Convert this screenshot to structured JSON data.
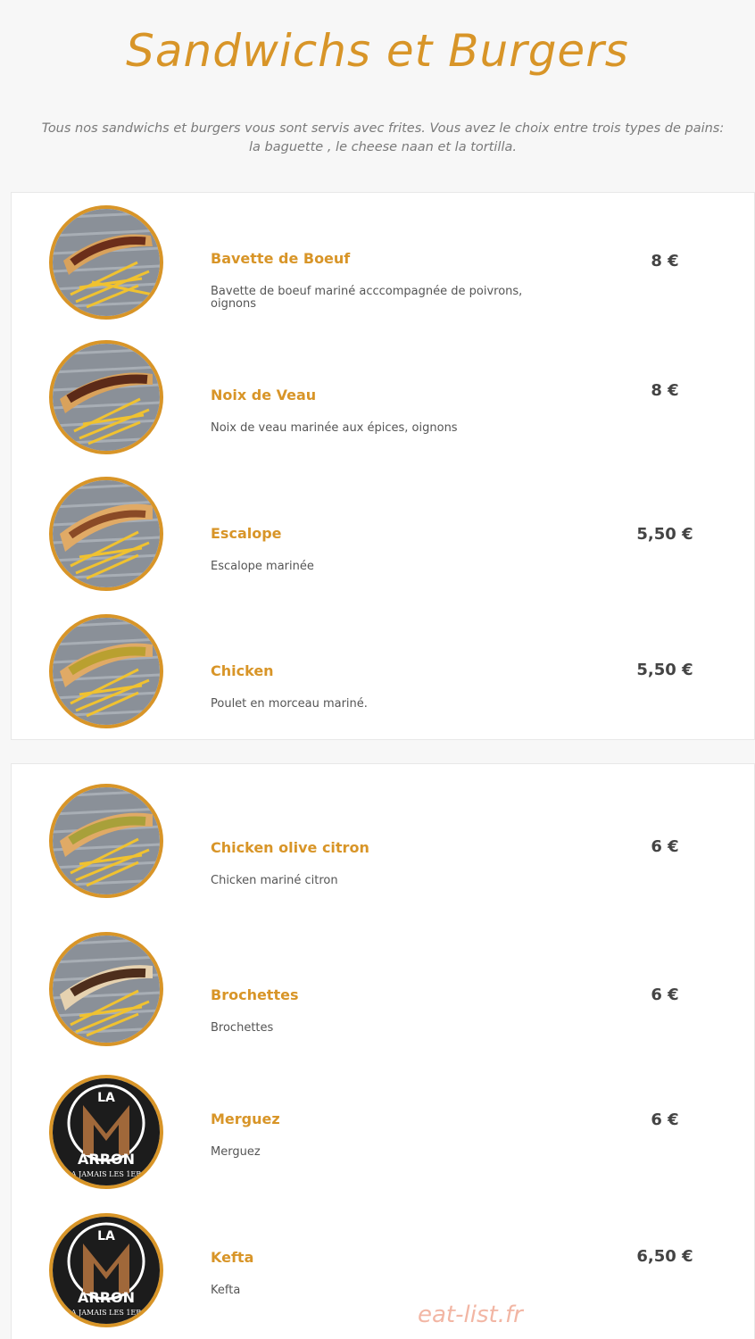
{
  "page": {
    "title": "Sandwichs et Burgers",
    "intro_line1": "Tous nos sandwichs et burgers vous sont servis avec frites. Vous avez le choix entre trois types de pains:",
    "intro_line2": "la baguette , le cheese naan et la tortilla."
  },
  "colors": {
    "accent": "#d89528",
    "price": "#444444",
    "text": "#555555",
    "background": "#f7f7f7"
  },
  "menu_group_1": [
    {
      "name": "Bavette de Boeuf",
      "description": "Bavette de boeuf mariné acccompagnée de poivrons, oignons",
      "price": "8 €",
      "image": "sandwich-fries-photo"
    },
    {
      "name": "Noix de Veau",
      "description": "Noix de veau marinée aux épices, oignons",
      "price": "8 €",
      "image": "sandwich-fries-photo"
    },
    {
      "name": "Escalope",
      "description": "Escalope marinée",
      "price": "5,50 €",
      "image": "sandwich-fries-photo"
    },
    {
      "name": "Chicken",
      "description": "Poulet en morceau mariné.",
      "price": "5,50 €",
      "image": "sandwich-fries-photo"
    }
  ],
  "menu_group_2": [
    {
      "name": "Chicken olive citron",
      "description": "Chicken mariné citron",
      "price": "6 €",
      "image": "sandwich-fries-photo"
    },
    {
      "name": "Brochettes",
      "description": "Brochettes",
      "price": "6 €",
      "image": "sandwich-fries-photo"
    },
    {
      "name": "Merguez",
      "description": "Merguez",
      "price": "6 €",
      "image": "la-marron-logo",
      "logo_text": [
        "LA",
        "ARRON",
        "A JAMAIS LES 1ER"
      ]
    },
    {
      "name": "Kefta",
      "description": "Kefta",
      "price": "6,50 €",
      "image": "la-marron-logo",
      "logo_text": [
        "LA",
        "ARRON",
        "A JAMAIS LES 1ER"
      ]
    }
  ],
  "watermark": "eat-list.fr"
}
